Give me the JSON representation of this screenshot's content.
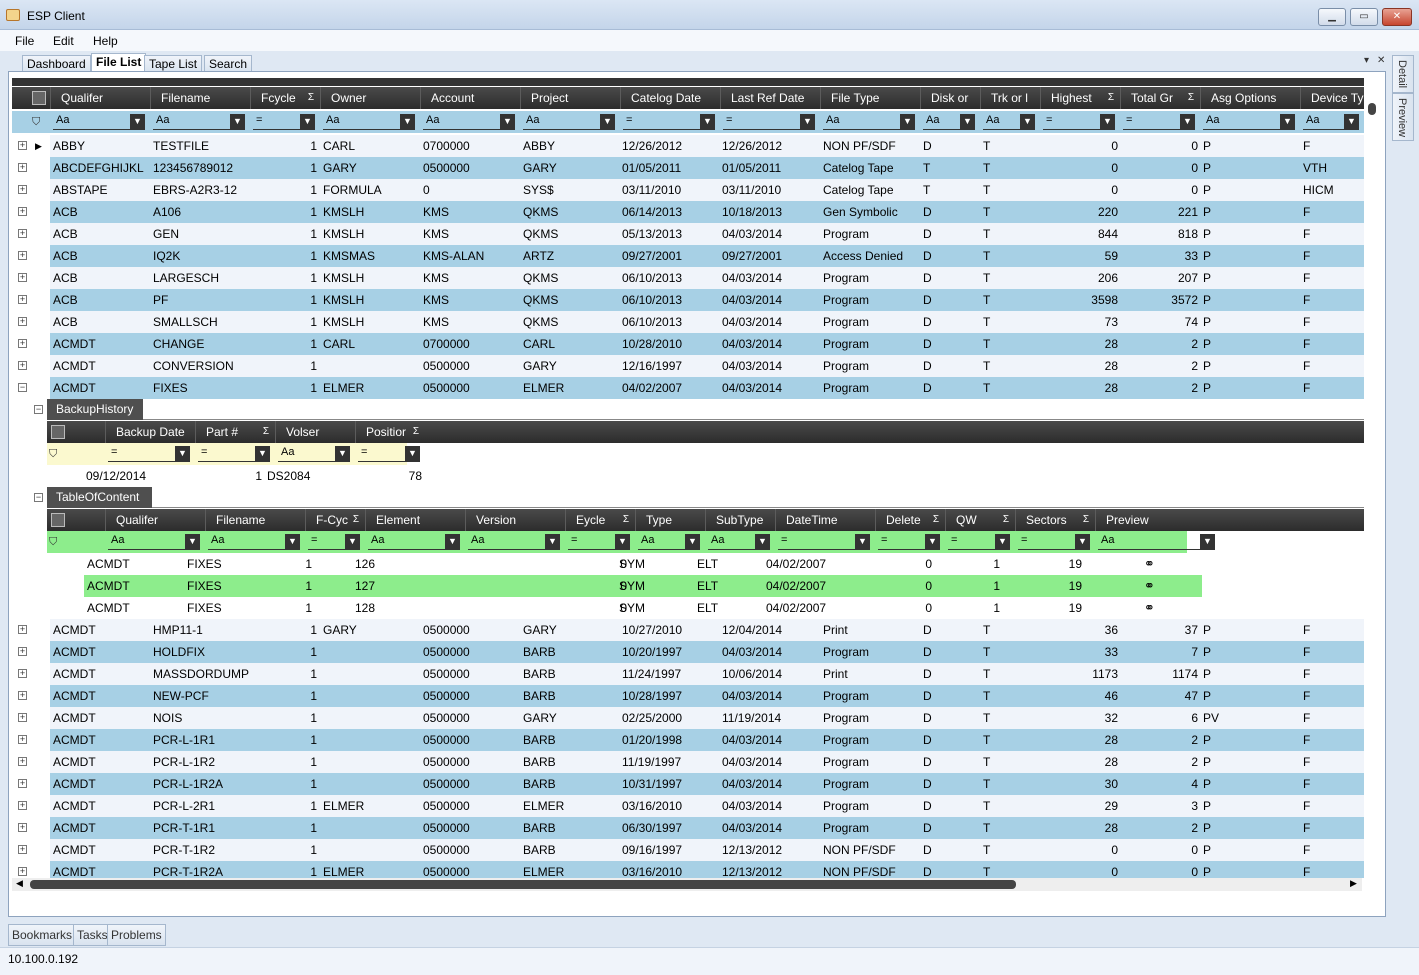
{
  "window": {
    "title": "ESP Client",
    "min": "▁",
    "max": "▭",
    "close": "✕"
  },
  "menu": [
    "File",
    "Edit",
    "Help"
  ],
  "doc_tabs": [
    "Dashboard",
    "File List",
    "Tape List",
    "Search"
  ],
  "doc_tabs_active": "File List",
  "doc_tab_controls": {
    "dropdown": "▾",
    "close": "✕"
  },
  "side_tabs": [
    "Detail",
    "Preview"
  ],
  "main_grid": {
    "columns": [
      {
        "label": "Qualifer",
        "sum": false
      },
      {
        "label": "Filename",
        "sum": false
      },
      {
        "label": "Fcycle",
        "sum": true
      },
      {
        "label": "Owner",
        "sum": false
      },
      {
        "label": "Account",
        "sum": false
      },
      {
        "label": "Project",
        "sum": false
      },
      {
        "label": "Catelog Date",
        "sum": false
      },
      {
        "label": "Last Ref Date",
        "sum": false
      },
      {
        "label": "File Type",
        "sum": false
      },
      {
        "label": "Disk or",
        "sum": false
      },
      {
        "label": "Trk or l",
        "sum": false
      },
      {
        "label": "Highest",
        "sum": true
      },
      {
        "label": "Total Gr",
        "sum": true
      },
      {
        "label": "Asg Options",
        "sum": false
      },
      {
        "label": "Device Ty",
        "sum": false
      }
    ],
    "filters": [
      "Aa",
      "Aa",
      "=",
      "Aa",
      "Aa",
      "Aa",
      "=",
      "=",
      "Aa",
      "Aa",
      "Aa",
      "=",
      "=",
      "Aa",
      "Aa"
    ],
    "rows_top": [
      [
        "ABBY",
        "TESTFILE",
        "1",
        "CARL",
        "0700000",
        "ABBY",
        "12/26/2012",
        "12/26/2012",
        "NON PF/SDF",
        "D",
        "T",
        "0",
        "0",
        "P",
        "F"
      ],
      [
        "ABCDEFGHIJKL",
        "123456789012",
        "1",
        "GARY",
        "0500000",
        "GARY",
        "01/05/2011",
        "01/05/2011",
        "Catelog Tape",
        "T",
        "T",
        "0",
        "0",
        "P",
        "VTH"
      ],
      [
        "ABSTAPE",
        "EBRS-A2R3-12",
        "1",
        "FORMULA",
        "0",
        "SYS$",
        "03/11/2010",
        "03/11/2010",
        "Catelog Tape",
        "T",
        "T",
        "0",
        "0",
        "P",
        "HICM"
      ],
      [
        "ACB",
        "A106",
        "1",
        "KMSLH",
        "KMS",
        "QKMS",
        "06/14/2013",
        "10/18/2013",
        "Gen Symbolic",
        "D",
        "T",
        "220",
        "221",
        "P",
        "F"
      ],
      [
        "ACB",
        "GEN",
        "1",
        "KMSLH",
        "KMS",
        "QKMS",
        "05/13/2013",
        "04/03/2014",
        "Program",
        "D",
        "T",
        "844",
        "818",
        "P",
        "F"
      ],
      [
        "ACB",
        "IQ2K",
        "1",
        "KMSMAS",
        "KMS-ALAN",
        "ARTZ",
        "09/27/2001",
        "09/27/2001",
        "Access Denied",
        "D",
        "T",
        "59",
        "33",
        "P",
        "F"
      ],
      [
        "ACB",
        "LARGESCH",
        "1",
        "KMSLH",
        "KMS",
        "QKMS",
        "06/10/2013",
        "04/03/2014",
        "Program",
        "D",
        "T",
        "206",
        "207",
        "P",
        "F"
      ],
      [
        "ACB",
        "PF",
        "1",
        "KMSLH",
        "KMS",
        "QKMS",
        "06/10/2013",
        "04/03/2014",
        "Program",
        "D",
        "T",
        "3598",
        "3572",
        "P",
        "F"
      ],
      [
        "ACB",
        "SMALLSCH",
        "1",
        "KMSLH",
        "KMS",
        "QKMS",
        "06/10/2013",
        "04/03/2014",
        "Program",
        "D",
        "T",
        "73",
        "74",
        "P",
        "F"
      ],
      [
        "ACMDT",
        "CHANGE",
        "1",
        "CARL",
        "0700000",
        "CARL",
        "10/28/2010",
        "04/03/2014",
        "Program",
        "D",
        "T",
        "28",
        "2",
        "P",
        "F"
      ],
      [
        "ACMDT",
        "CONVERSION",
        "1",
        "",
        "0500000",
        "GARY",
        "12/16/1997",
        "04/03/2014",
        "Program",
        "D",
        "T",
        "28",
        "2",
        "P",
        "F"
      ],
      [
        "ACMDT",
        "FIXES",
        "1",
        "ELMER",
        "0500000",
        "ELMER",
        "04/02/2007",
        "04/03/2014",
        "Program",
        "D",
        "T",
        "28",
        "2",
        "P",
        "F"
      ]
    ],
    "rows_bottom": [
      [
        "ACMDT",
        "HMP11-1",
        "1",
        "GARY",
        "0500000",
        "GARY",
        "10/27/2010",
        "12/04/2014",
        "Print",
        "D",
        "T",
        "36",
        "37",
        "P",
        "F"
      ],
      [
        "ACMDT",
        "HOLDFIX",
        "1",
        "",
        "0500000",
        "BARB",
        "10/20/1997",
        "04/03/2014",
        "Program",
        "D",
        "T",
        "33",
        "7",
        "P",
        "F"
      ],
      [
        "ACMDT",
        "MASSDORDUMP",
        "1",
        "",
        "0500000",
        "BARB",
        "11/24/1997",
        "10/06/2014",
        "Print",
        "D",
        "T",
        "1173",
        "1174",
        "P",
        "F"
      ],
      [
        "ACMDT",
        "NEW-PCF",
        "1",
        "",
        "0500000",
        "BARB",
        "10/28/1997",
        "04/03/2014",
        "Program",
        "D",
        "T",
        "46",
        "47",
        "P",
        "F"
      ],
      [
        "ACMDT",
        "NOIS",
        "1",
        "",
        "0500000",
        "GARY",
        "02/25/2000",
        "11/19/2014",
        "Program",
        "D",
        "T",
        "32",
        "6",
        "PV",
        "F"
      ],
      [
        "ACMDT",
        "PCR-L-1R1",
        "1",
        "",
        "0500000",
        "BARB",
        "01/20/1998",
        "04/03/2014",
        "Program",
        "D",
        "T",
        "28",
        "2",
        "P",
        "F"
      ],
      [
        "ACMDT",
        "PCR-L-1R2",
        "1",
        "",
        "0500000",
        "BARB",
        "11/19/1997",
        "04/03/2014",
        "Program",
        "D",
        "T",
        "28",
        "2",
        "P",
        "F"
      ],
      [
        "ACMDT",
        "PCR-L-1R2A",
        "1",
        "",
        "0500000",
        "BARB",
        "10/31/1997",
        "04/03/2014",
        "Program",
        "D",
        "T",
        "30",
        "4",
        "P",
        "F"
      ],
      [
        "ACMDT",
        "PCR-L-2R1",
        "1",
        "ELMER",
        "0500000",
        "ELMER",
        "03/16/2010",
        "04/03/2014",
        "Program",
        "D",
        "T",
        "29",
        "3",
        "P",
        "F"
      ],
      [
        "ACMDT",
        "PCR-T-1R1",
        "1",
        "",
        "0500000",
        "BARB",
        "06/30/1997",
        "04/03/2014",
        "Program",
        "D",
        "T",
        "28",
        "2",
        "P",
        "F"
      ],
      [
        "ACMDT",
        "PCR-T-1R2",
        "1",
        "",
        "0500000",
        "BARB",
        "09/16/1997",
        "12/13/2012",
        "NON PF/SDF",
        "D",
        "T",
        "0",
        "0",
        "P",
        "F"
      ],
      [
        "ACMDT",
        "PCR-T-1R2A",
        "1",
        "ELMER",
        "0500000",
        "ELMER",
        "03/16/2010",
        "12/13/2012",
        "NON PF/SDF",
        "D",
        "T",
        "0",
        "0",
        "P",
        "F"
      ]
    ]
  },
  "backup_history": {
    "label": "BackupHistory",
    "columns": [
      {
        "label": "Backup Date",
        "sum": false
      },
      {
        "label": "Part #",
        "sum": true
      },
      {
        "label": "Volser",
        "sum": false
      },
      {
        "label": "Positior",
        "sum": true
      }
    ],
    "filters": [
      "=",
      "=",
      "Aa",
      "="
    ],
    "rows": [
      [
        "09/12/2014",
        "1",
        "DS2084",
        "78"
      ]
    ]
  },
  "table_of_content": {
    "label": "TableOfContent",
    "columns": [
      {
        "label": "Qualifer",
        "sum": false
      },
      {
        "label": "Filename",
        "sum": false
      },
      {
        "label": "F-Cyc",
        "sum": true
      },
      {
        "label": "Element",
        "sum": false
      },
      {
        "label": "Version",
        "sum": false
      },
      {
        "label": "Eycle",
        "sum": true
      },
      {
        "label": "Type",
        "sum": false
      },
      {
        "label": "SubType",
        "sum": false
      },
      {
        "label": "DateTime",
        "sum": false
      },
      {
        "label": "Delete",
        "sum": true
      },
      {
        "label": "QW",
        "sum": true
      },
      {
        "label": "Sectors",
        "sum": true
      },
      {
        "label": "Preview",
        "sum": false
      }
    ],
    "filters": [
      "Aa",
      "Aa",
      "=",
      "Aa",
      "Aa",
      "=",
      "Aa",
      "Aa",
      "=",
      "=",
      "=",
      "=",
      "Aa"
    ],
    "rows": [
      [
        "ACMDT",
        "FIXES",
        "1",
        "126",
        "",
        "0",
        "SYM",
        "ELT",
        "04/02/2007",
        "0",
        "1",
        "19"
      ],
      [
        "ACMDT",
        "FIXES",
        "1",
        "127",
        "",
        "0",
        "SYM",
        "ELT",
        "04/02/2007",
        "0",
        "1",
        "19"
      ],
      [
        "ACMDT",
        "FIXES",
        "1",
        "128",
        "",
        "0",
        "SYM",
        "ELT",
        "04/02/2007",
        "0",
        "1",
        "19"
      ]
    ],
    "selected_row": 1
  },
  "bottom_tabs": [
    "Bookmarks",
    "Tasks",
    "Problems"
  ],
  "status": {
    "address": "10.100.0.192"
  },
  "icons": {
    "filter": "funnel-icon",
    "expand": "plus-icon",
    "collapse": "minus-icon",
    "preview": "binoculars-icon",
    "columns": "column-chooser-icon"
  },
  "colors": {
    "row_alt": "#a7d0e5",
    "row_selected": "#8ded8c",
    "header": "#333333",
    "filter_yellow": "#fbf9cf"
  }
}
